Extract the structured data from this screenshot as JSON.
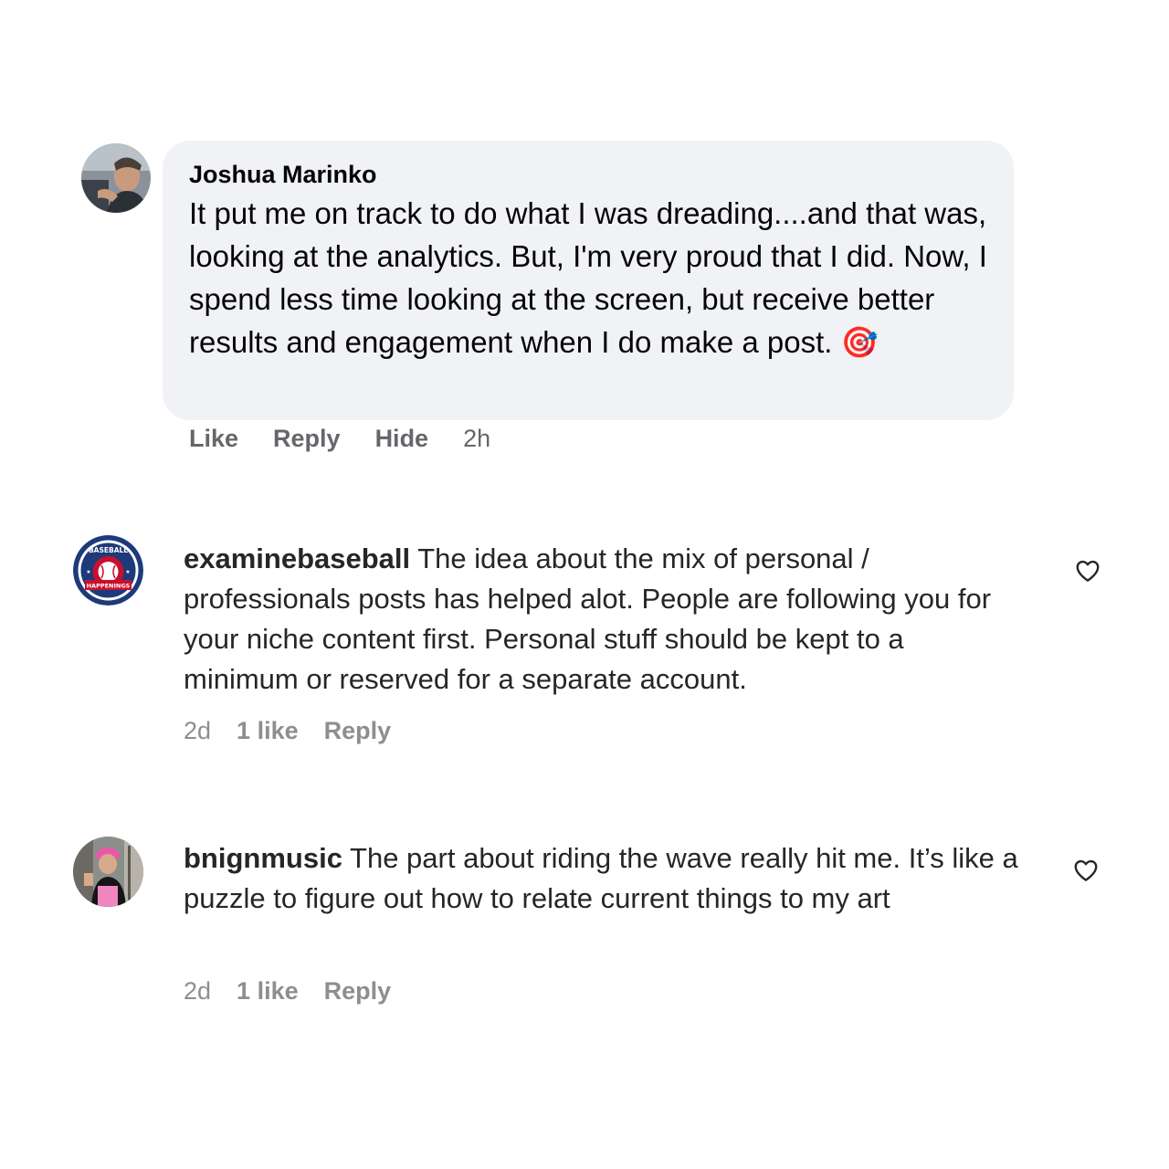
{
  "fb_comment": {
    "author": "Joshua Marinko",
    "text": "It put me on track to do what I was dreading....and that was, looking at the analytics. But, I'm very proud that I did. Now, I spend less time looking at the screen, but receive better results and engagement when I do make a post.",
    "emoji": "🎯",
    "actions": {
      "like": "Like",
      "reply": "Reply",
      "hide": "Hide"
    },
    "time": "2h"
  },
  "ig_comments": [
    {
      "username": "examinebaseball",
      "text": "The idea about the mix of personal / professionals posts has helped alot. People are following you for your niche content first. Personal stuff should be kept to a minimum or reserved for a separate account.",
      "time": "2d",
      "likes": "1 like",
      "reply": "Reply",
      "avatar_badge_top": "BASEBALL",
      "avatar_badge_bottom": "HAPPENINGS"
    },
    {
      "username": "bnignmusic",
      "text": "The part about riding the wave really hit me. It’s like a puzzle to figure out how to relate current things to my art",
      "time": "2d",
      "likes": "1 like",
      "reply": "Reply"
    }
  ],
  "colors": {
    "bubble_bg": "#f0f2f5",
    "fb_meta": "#65676b",
    "ig_meta": "#8e8e8e",
    "text": "#262626"
  }
}
